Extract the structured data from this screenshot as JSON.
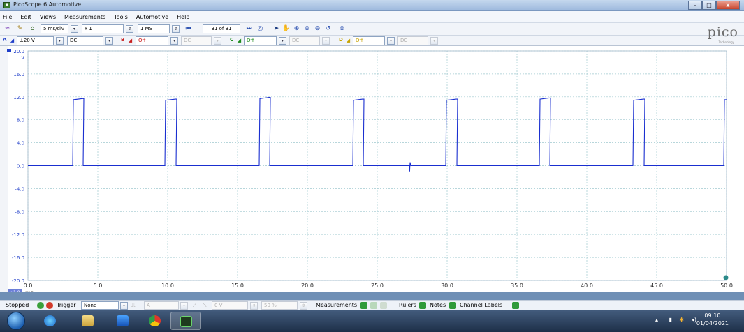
{
  "window": {
    "title": "PicoScope 6 Automotive",
    "min": "–",
    "max": "□",
    "close": "x"
  },
  "menu": [
    "File",
    "Edit",
    "Views",
    "Measurements",
    "Tools",
    "Automotive",
    "Help"
  ],
  "toolbar": {
    "timebase": "5 ms/div",
    "zoom": "x 1",
    "samples": "1 MS",
    "buffer": "31 of 31"
  },
  "channels": {
    "a": {
      "label": "A",
      "range": "±20 V",
      "coupling": "DC"
    },
    "b": {
      "label": "B",
      "range": "Off",
      "coupling": "DC"
    },
    "c": {
      "label": "C",
      "range": "Off",
      "coupling": "DC"
    },
    "d": {
      "label": "D",
      "range": "Off",
      "coupling": "DC"
    }
  },
  "logo": {
    "name": "pico",
    "sub": "Technology"
  },
  "scope": {
    "y_unit": "V",
    "x_unit": "ms",
    "x_zoom_badge": "x1.0",
    "y_ticks": [
      "20.0",
      "16.0",
      "12.0",
      "8.0",
      "4.0",
      "0.0",
      "-4.0",
      "-8.0",
      "-12.0",
      "-16.0",
      "-20.0"
    ],
    "x_ticks": [
      "0.0",
      "5.0",
      "10.0",
      "15.0",
      "20.0",
      "25.0",
      "30.0",
      "35.0",
      "40.0",
      "45.0",
      "50.0"
    ],
    "trace_color": "#1a2fd0",
    "grid_color": "#9fc8cf"
  },
  "chart_data": {
    "type": "line",
    "xlabel": "ms",
    "ylabel": "V",
    "xlim": [
      0,
      50
    ],
    "ylim": [
      -20,
      20
    ],
    "grid": true,
    "series": [
      {
        "x": [
          0.0,
          3.2,
          3.25,
          3.9,
          4.0,
          3.95,
          9.8,
          9.85,
          10.55,
          10.65,
          10.6,
          16.55,
          16.6,
          17.25,
          17.35,
          17.3,
          23.25,
          23.3,
          23.95,
          24.05,
          24.0,
          27.3,
          27.32,
          27.35,
          27.4,
          29.9,
          29.95,
          30.65,
          30.75,
          30.7,
          36.6,
          36.65,
          37.3,
          37.4,
          37.35,
          43.3,
          43.35,
          44.05,
          44.15,
          44.1,
          49.8,
          49.85,
          50.0
        ],
        "y": [
          0.0,
          0.0,
          11.5,
          11.7,
          11.7,
          0.0,
          0.0,
          11.4,
          11.6,
          11.6,
          0.0,
          0.0,
          11.7,
          11.9,
          11.9,
          0.0,
          0.0,
          11.4,
          11.6,
          11.6,
          0.0,
          0.0,
          -1.0,
          0.6,
          0.0,
          0.0,
          11.4,
          11.6,
          11.6,
          0.0,
          0.0,
          11.6,
          11.8,
          11.8,
          0.0,
          0.0,
          11.4,
          11.6,
          11.6,
          0.0,
          0.0,
          11.5,
          11.5
        ]
      }
    ]
  },
  "statusbar": {
    "state": "Stopped",
    "trigger_label": "Trigger",
    "trigger_mode": "None",
    "trigger_source": "A",
    "trigger_level": "0 V",
    "pretrigger": "50 %",
    "measurements": "Measurements",
    "rulers": "Rulers",
    "notes": "Notes",
    "channel_labels": "Channel Labels"
  },
  "taskbar": {
    "time": "09:10",
    "date": "01/04/2021"
  },
  "colors": {
    "channel_a": "#1f3ec9",
    "channel_b": "#c81e1e",
    "channel_c": "#1b8a1b",
    "channel_d": "#c7a300"
  }
}
